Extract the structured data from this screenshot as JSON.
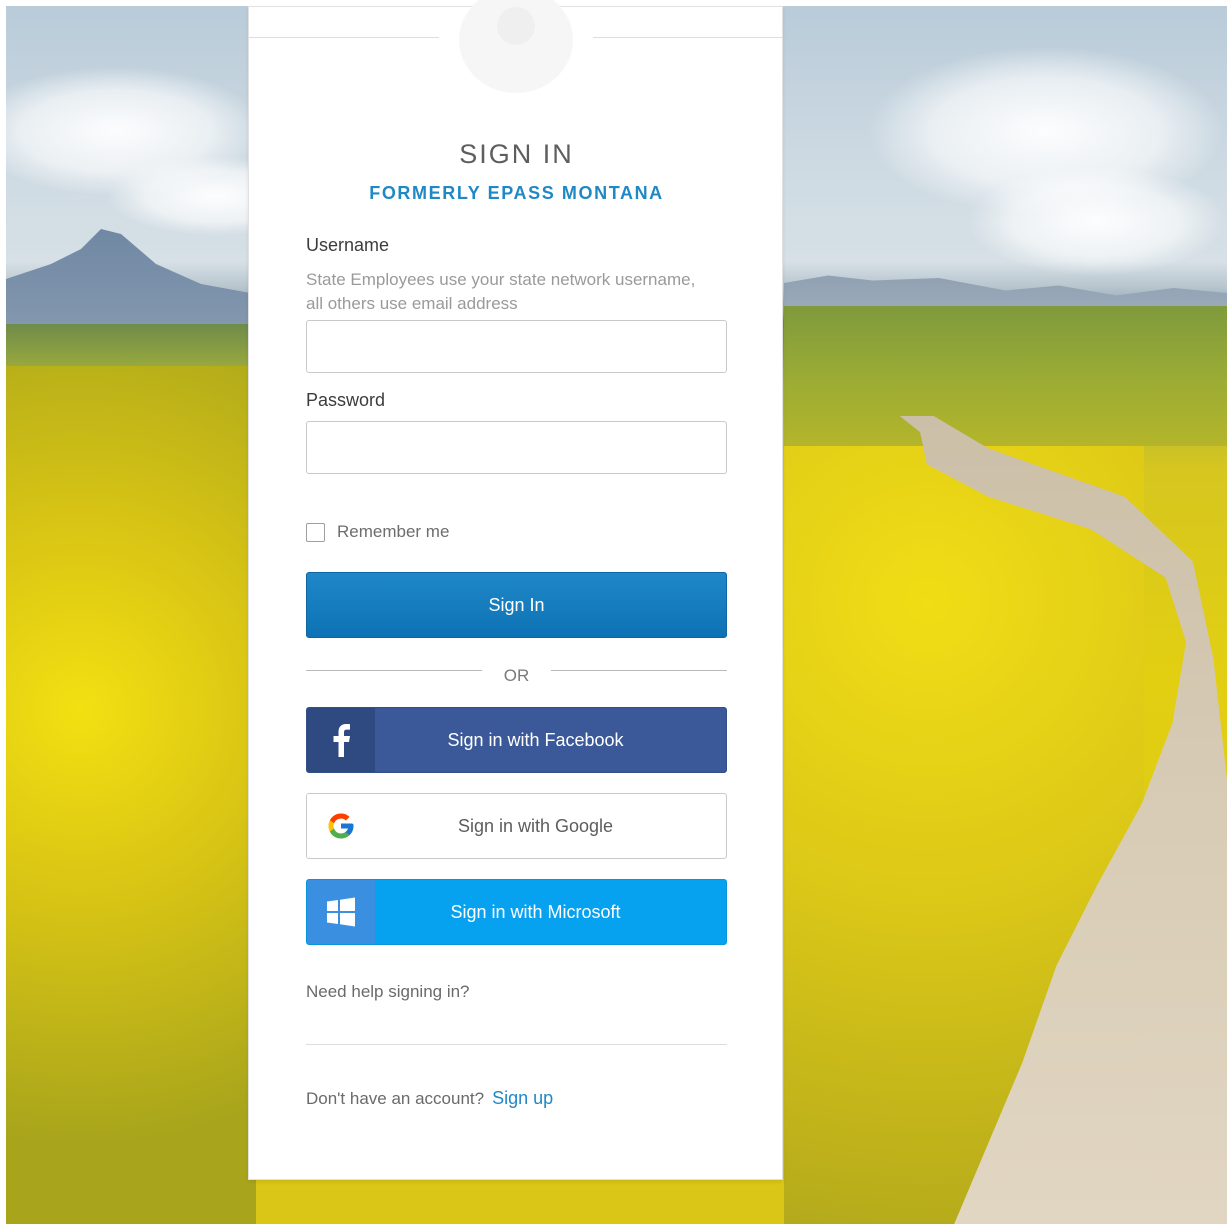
{
  "header": {
    "title": "SIGN IN",
    "subtitle": "FORMERLY EPASS MONTANA"
  },
  "username": {
    "label": "Username",
    "hint": "State Employees use your state network username, all others use email address",
    "value": ""
  },
  "password": {
    "label": "Password",
    "value": ""
  },
  "remember": {
    "label": "Remember me",
    "checked": false
  },
  "buttons": {
    "sign_in": "Sign In",
    "or": "OR",
    "facebook": "Sign in with Facebook",
    "google": "Sign in with Google",
    "microsoft": "Sign in with Microsoft"
  },
  "icons": {
    "facebook": "facebook-icon",
    "google": "google-icon",
    "microsoft": "windows-icon",
    "avatar": "user-avatar-icon"
  },
  "links": {
    "help": "Need help signing in?",
    "no_account": "Don't have an account?",
    "signup": "Sign up"
  },
  "colors": {
    "accent": "#1f88c5",
    "primary_button": "#0d72b5",
    "facebook": "#3b5998",
    "microsoft": "#06a2ef"
  }
}
